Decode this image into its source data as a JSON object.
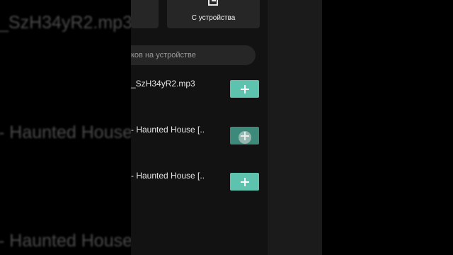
{
  "background": {
    "line1": "_SzH34yR2.mp3",
    "line2": "- Haunted House",
    "line3": "- Haunted House"
  },
  "header": {
    "device_tile_label": "С устройства",
    "device_tile_icon": "import-file-icon"
  },
  "search": {
    "text": "ков на устройстве"
  },
  "files": [
    {
      "title": "_SzH34yR2.mp3",
      "action_icon": "plus-icon"
    },
    {
      "title": "- Haunted House [..",
      "action_icon": "plus-icon"
    },
    {
      "title": "- Haunted House [..",
      "action_icon": "plus-icon"
    }
  ],
  "colors": {
    "accent": "#5ec3ae",
    "screen_bg": "#121212",
    "tile_bg": "#262626"
  }
}
